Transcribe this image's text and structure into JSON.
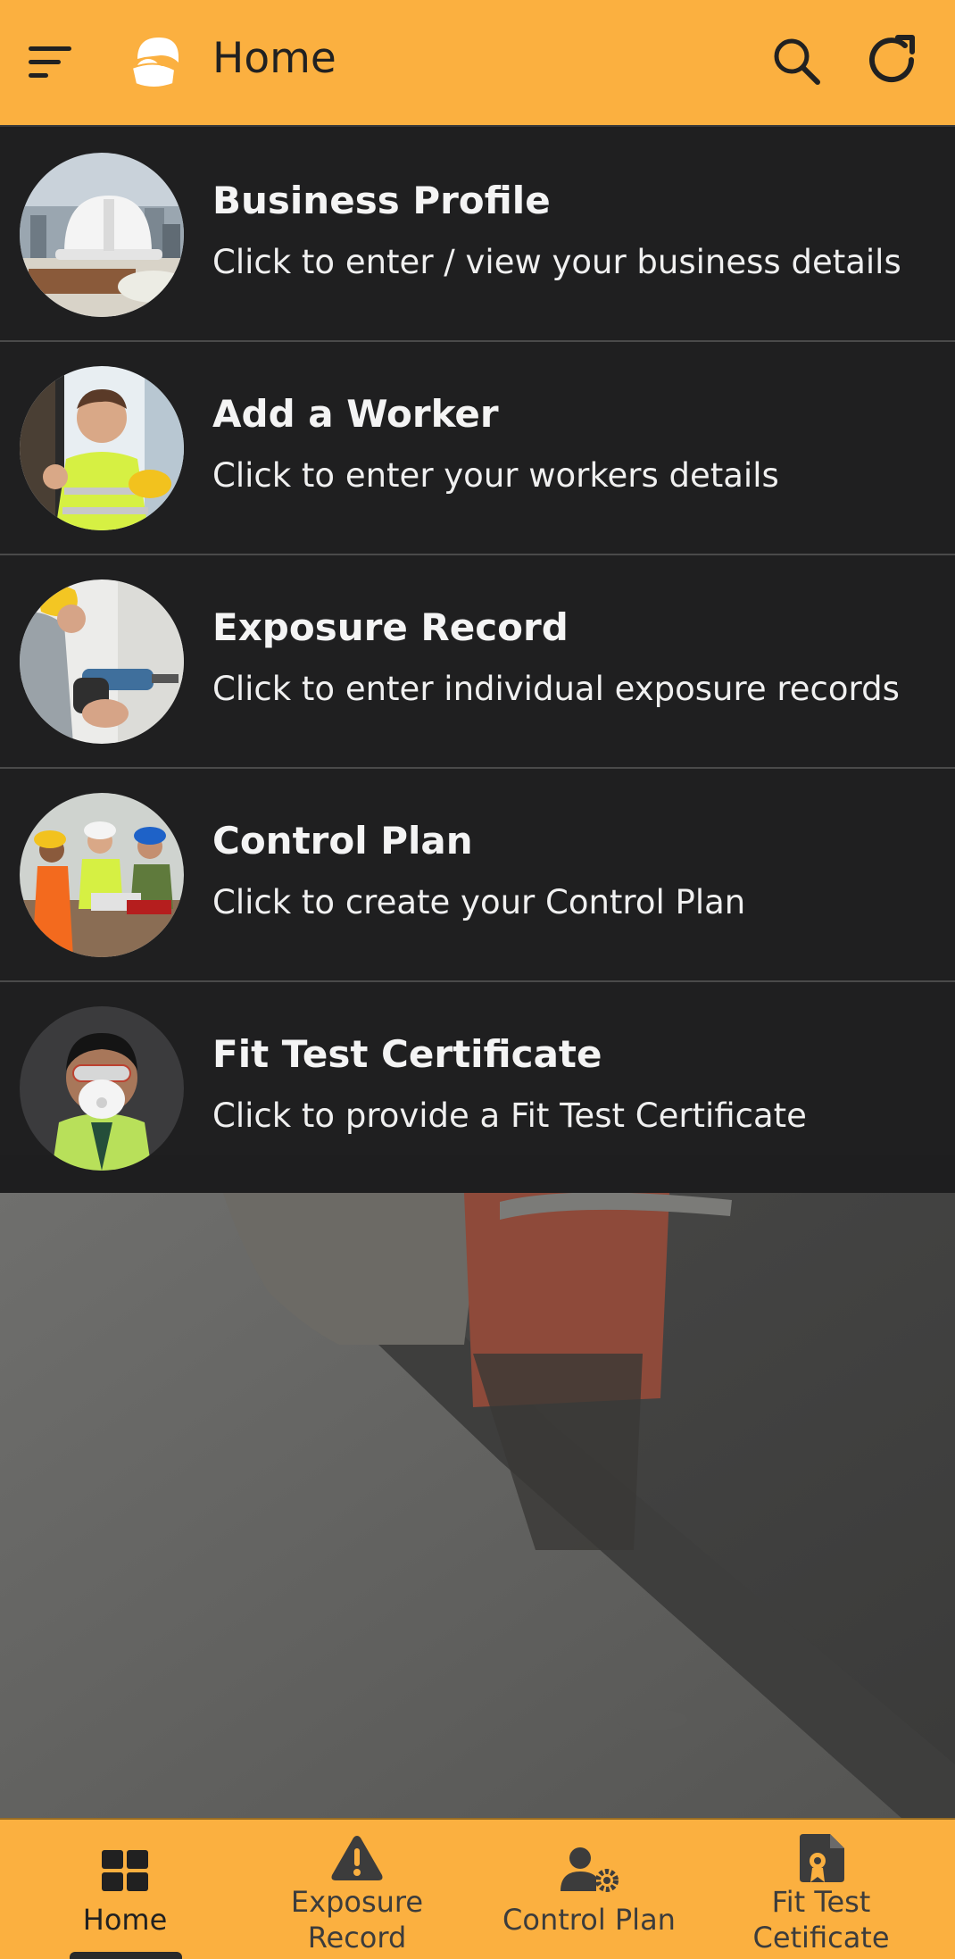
{
  "app_bar": {
    "title": "Home",
    "menu_icon": "sort-menu-icon",
    "logo_icon": "mask-worker-logo",
    "search_icon": "search-icon",
    "refresh_icon": "refresh-icon",
    "color": "#fbb040"
  },
  "menu_items": [
    {
      "title": "Business Profile",
      "subtitle": "Click to enter / view your business details",
      "image": "hard-hat-on-blueprints"
    },
    {
      "title": "Add a Worker",
      "subtitle": "Click to enter your workers details",
      "image": "worker-in-hi-vis-vest"
    },
    {
      "title": "Exposure Record",
      "subtitle": "Click to enter individual exposure records",
      "image": "worker-using-drill"
    },
    {
      "title": "Control Plan",
      "subtitle": "Click to create your Control Plan",
      "image": "workers-reviewing-plan"
    },
    {
      "title": "Fit Test Certificate",
      "subtitle": "Click to provide a Fit Test Certificate",
      "image": "worker-wearing-respirator-mask"
    }
  ],
  "background_image": "concrete-saw-cutting-dust",
  "bottom_nav": {
    "active": "Home",
    "items": [
      {
        "label": "Home",
        "icon": "grid-icon"
      },
      {
        "label_line1": "Exposure",
        "label_line2": "Record",
        "icon": "warning-icon"
      },
      {
        "label": "Control Plan",
        "icon": "user-gear-icon"
      },
      {
        "label_line1": "Fit Test",
        "label_line2": "Cetificate",
        "icon": "certificate-icon"
      }
    ]
  }
}
